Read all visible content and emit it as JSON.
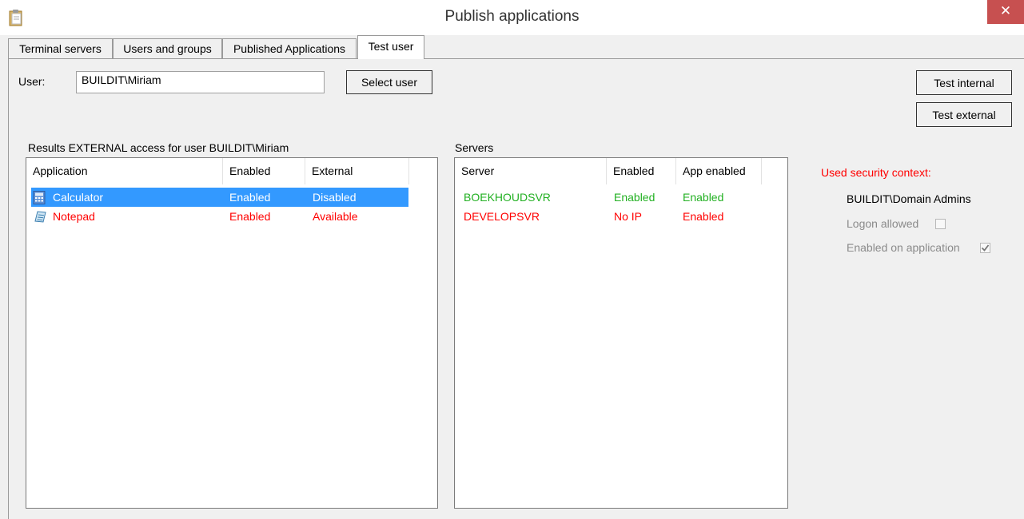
{
  "window": {
    "title": "Publish applications",
    "close_glyph": "✕"
  },
  "tabs": [
    {
      "label": "Terminal servers"
    },
    {
      "label": "Users and groups"
    },
    {
      "label": "Published Applications"
    },
    {
      "label": "Test user"
    }
  ],
  "test_user": {
    "user_label": "User:",
    "user_value": "BUILDIT\\Miriam",
    "select_user_button": "Select user",
    "test_internal_button": "Test internal",
    "test_external_button": "Test external",
    "results_label": "Results EXTERNAL access for user BUILDIT\\Miriam",
    "servers_label": "Servers"
  },
  "applications": {
    "columns": [
      "Application",
      "Enabled",
      "External"
    ],
    "rows": [
      {
        "icon": "calculator-icon",
        "name": "Calculator",
        "enabled": "Enabled",
        "external": "Disabled",
        "selected": true,
        "color": "#ff0000"
      },
      {
        "icon": "notepad-icon",
        "name": "Notepad",
        "enabled": "Enabled",
        "external": "Available",
        "selected": false,
        "color": "#ff0000"
      }
    ]
  },
  "servers": {
    "columns": [
      "Server",
      "Enabled",
      "App enabled"
    ],
    "rows": [
      {
        "server": "BOEKHOUDSVR",
        "enabled": "Enabled",
        "app_enabled": "Enabled",
        "color": "#22b022"
      },
      {
        "server": "DEVELOPSVR",
        "enabled": "No IP",
        "app_enabled": "Enabled",
        "color": "#ff0000"
      }
    ]
  },
  "security_context": {
    "heading": "Used security context:",
    "heading_color": "#ff0000",
    "group": "BUILDIT\\Domain Admins",
    "logon_allowed_label": "Logon allowed",
    "logon_allowed_checked": false,
    "enabled_on_app_label": "Enabled on application",
    "enabled_on_app_checked": true
  }
}
